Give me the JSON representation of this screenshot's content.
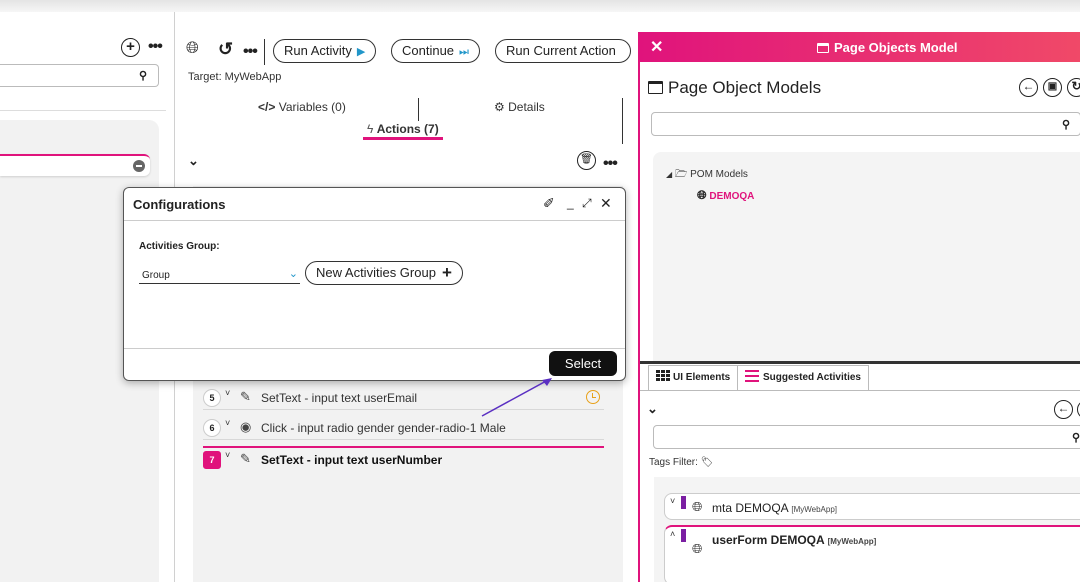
{
  "colors": {
    "accent": "#e0137c",
    "play": "#2196c9",
    "purple": "#7b1fa2",
    "arrow": "#5a2fc2"
  },
  "left": {
    "add_icon": "plus-circle-icon",
    "more_icon": "more-horizontal-icon",
    "search_icon": "search-icon"
  },
  "toolbar": {
    "run_activity": "Run Activity",
    "continue": "Continue",
    "run_current_action": "Run Current Action"
  },
  "target_label": "Target: MyWebApp",
  "tabs": {
    "variables": "Variables (0)",
    "details": "Details",
    "actions": "Actions (7)"
  },
  "actions": [
    {
      "num": "5",
      "text": "SetText - input text userEmail",
      "icon": "pencil-icon"
    },
    {
      "num": "6",
      "text": "Click - input radio gender gender-radio-1 Male",
      "icon": "radio-icon"
    },
    {
      "num": "7",
      "text": "SetText - input text userNumber",
      "icon": "pencil-icon"
    }
  ],
  "dialog": {
    "title": "Configurations",
    "group_label": "Activities Group:",
    "group_value": "Group",
    "new_group_label": "New Activities Group",
    "select_label": "Select"
  },
  "pom": {
    "window_title": "Page Objects Model",
    "subtitle": "Page Object Models",
    "tree_root": "POM Models",
    "tree_child": "DEMOQA",
    "tab_ui_elements": "UI Elements",
    "tab_suggested": "Suggested Activities",
    "tags_filter": "Tags Filter:",
    "elements": [
      {
        "name": "mta DEMOQA",
        "app": "[MyWebApp]"
      },
      {
        "name": "userForm DEMOQA",
        "app": "[MyWebApp]"
      }
    ]
  }
}
